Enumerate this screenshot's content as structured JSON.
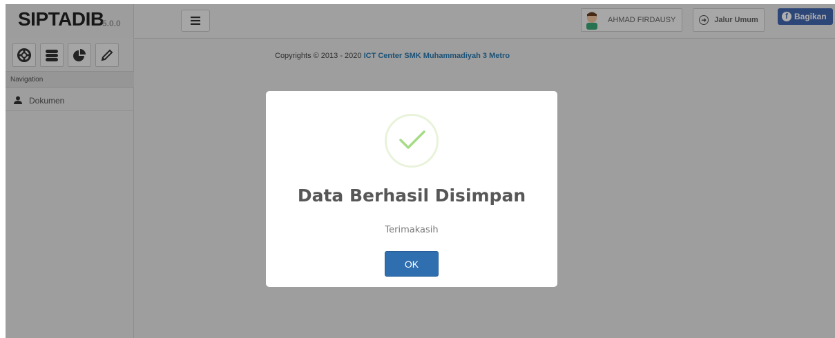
{
  "navbar": {
    "brand_name": "SIPTADIB",
    "brand_version": "5.0.0",
    "menu_toggle_icon": "hamburger-icon",
    "user_name": "AHMAD FIRDAUSY",
    "jalur_label": "Jalur Umum",
    "jalur_icon": "arrow-circle-right-icon",
    "share_label": "Bagikan",
    "share_icon": "facebook-icon",
    "share_color": "#4267b2"
  },
  "sidebar": {
    "shortcuts": [
      {
        "icon": "lifebuoy-icon"
      },
      {
        "icon": "database-icon"
      },
      {
        "icon": "pie-chart-icon"
      },
      {
        "icon": "pencil-icon"
      }
    ],
    "nav_header": "Navigation",
    "items": [
      {
        "label": "Dokumen",
        "icon": "user-icon"
      }
    ]
  },
  "main": {
    "copyright_prefix": "Copyrights © 2013 - 2020 ",
    "copyright_org": "ICT Center SMK Muhammadiyah 3 Metro",
    "link_color": "#2a7ab0"
  },
  "modal": {
    "icon": "success-check-icon",
    "title": "Data Berhasil Disimpan",
    "text": "Terimakasih",
    "ok_label": "OK",
    "ok_color": "#2f6fb0",
    "check_color": "#a5dc86"
  }
}
